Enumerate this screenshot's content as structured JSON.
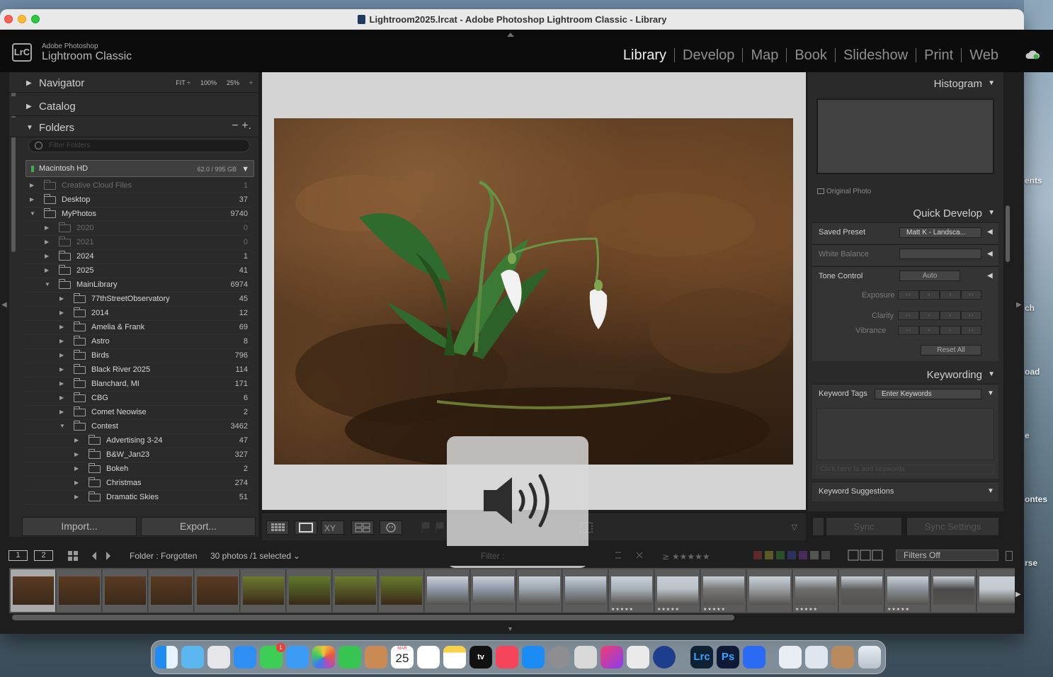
{
  "window": {
    "title": "Lightroom2025.lrcat - Adobe Photoshop Lightroom Classic - Library"
  },
  "brand": {
    "sub": "Adobe Photoshop",
    "main": "Lightroom Classic",
    "badge": "LrC"
  },
  "modules": [
    "Library",
    "Develop",
    "Map",
    "Book",
    "Slideshow",
    "Print",
    "Web"
  ],
  "left": {
    "navigator": "Navigator",
    "nav_zoom": [
      "FIT ÷",
      "100%",
      "25%",
      "÷"
    ],
    "catalog": "Catalog",
    "folders": "Folders",
    "folders_ctrl": "−  +.",
    "filter_placeholder": "Filter Folders",
    "volume": {
      "name": "Macintosh HD",
      "size": "62.0 / 995 GB"
    },
    "folders_list": [
      {
        "name": "Creative Cloud Files",
        "count": "1",
        "indent": 0,
        "dim": true,
        "open": false
      },
      {
        "name": "Desktop",
        "count": "37",
        "indent": 0,
        "dim": false,
        "open": false
      },
      {
        "name": "MyPhotos",
        "count": "9740",
        "indent": 0,
        "dim": false,
        "open": true
      },
      {
        "name": "2020",
        "count": "0",
        "indent": 1,
        "dim": true,
        "open": false
      },
      {
        "name": "2021",
        "count": "0",
        "indent": 1,
        "dim": true,
        "open": false
      },
      {
        "name": "2024",
        "count": "1",
        "indent": 1,
        "dim": false,
        "open": false
      },
      {
        "name": "2025",
        "count": "41",
        "indent": 1,
        "dim": false,
        "open": false
      },
      {
        "name": "MainLibrary",
        "count": "6974",
        "indent": 1,
        "dim": false,
        "open": true
      },
      {
        "name": "77thStreetObservatory",
        "count": "45",
        "indent": 2,
        "dim": false,
        "open": false
      },
      {
        "name": "2014",
        "count": "12",
        "indent": 2,
        "dim": false,
        "open": false
      },
      {
        "name": "Amelia & Frank",
        "count": "69",
        "indent": 2,
        "dim": false,
        "open": false
      },
      {
        "name": "Astro",
        "count": "8",
        "indent": 2,
        "dim": false,
        "open": false
      },
      {
        "name": "Birds",
        "count": "796",
        "indent": 2,
        "dim": false,
        "open": false
      },
      {
        "name": "Black River 2025",
        "count": "114",
        "indent": 2,
        "dim": false,
        "open": false
      },
      {
        "name": "Blanchard, MI",
        "count": "171",
        "indent": 2,
        "dim": false,
        "open": false
      },
      {
        "name": "CBG",
        "count": "6",
        "indent": 2,
        "dim": false,
        "open": false
      },
      {
        "name": "Comet Neowise",
        "count": "2",
        "indent": 2,
        "dim": false,
        "open": false
      },
      {
        "name": "Contest",
        "count": "3462",
        "indent": 2,
        "dim": false,
        "open": true
      },
      {
        "name": "Advertising 3-24",
        "count": "47",
        "indent": 3,
        "dim": false,
        "open": false
      },
      {
        "name": "B&W_Jan23",
        "count": "327",
        "indent": 3,
        "dim": false,
        "open": false
      },
      {
        "name": "Bokeh",
        "count": "2",
        "indent": 3,
        "dim": false,
        "open": false
      },
      {
        "name": "Christmas",
        "count": "274",
        "indent": 3,
        "dim": false,
        "open": false
      },
      {
        "name": "Dramatic Skies",
        "count": "51",
        "indent": 3,
        "dim": false,
        "open": false
      }
    ],
    "import": "Import...",
    "export": "Export..."
  },
  "right": {
    "histogram": "Histogram",
    "original_photo": "Original Photo",
    "quick_develop": "Quick Develop",
    "saved_preset_label": "Saved Preset",
    "saved_preset_value": "Matt K - Landsca...",
    "white_balance": "White Balance",
    "tone_control": "Tone Control",
    "auto": "Auto",
    "exposure": "Exposure",
    "clarity": "Clarity",
    "vibrance": "Vibrance",
    "reset_all": "Reset All",
    "keywording": "Keywording",
    "keyword_tags": "Keyword Tags",
    "enter_keywords": "Enter Keywords",
    "click_add": "Click here to add keywords",
    "keyword_suggestions": "Keyword Suggestions",
    "sync": "Sync",
    "sync_settings": "Sync Settings"
  },
  "filmbar": {
    "screen1": "1",
    "screen2": "2",
    "folder": "Folder : Forgotten",
    "count": "30 photos /1 selected",
    "filter_label": "Filter :",
    "filters_off": "Filters Off"
  },
  "hud": {
    "level": 1.0
  },
  "desktop_peek": [
    "ts",
    "ents",
    "ch",
    "oad",
    "e",
    "ontes",
    "rse"
  ],
  "dock": {
    "calendar_month": "MAR",
    "calendar_day": "25",
    "messages_badge": "1",
    "tv": "tv",
    "lrc": "Lrc",
    "ps": "Ps"
  }
}
